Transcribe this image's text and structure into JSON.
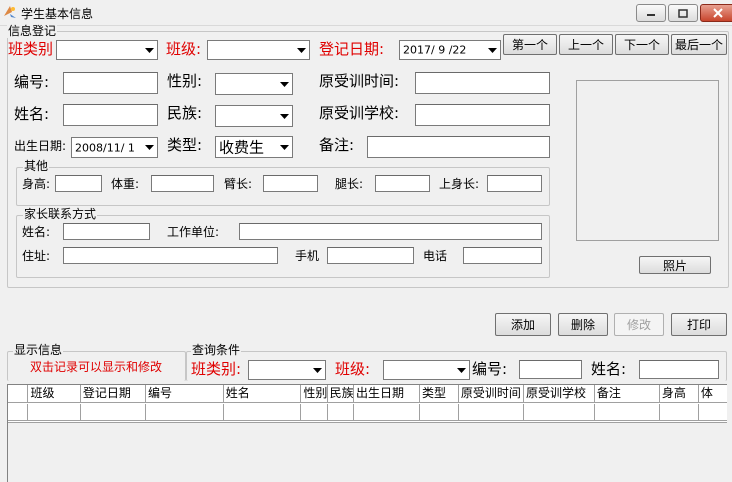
{
  "window": {
    "title": "学生基本信息"
  },
  "info_group": {
    "legend": "信息登记",
    "class_type_label": "班类别",
    "class_label": "班级:",
    "reg_date_label": "登记日期:",
    "reg_date_value": "2017/ 9 /22",
    "nav_first": "第一个",
    "nav_prev": "上一个",
    "nav_next": "下一个",
    "nav_last": "最后一个",
    "id_label": "编号:",
    "gender_label": "性别:",
    "orig_time_label": "原受训时间:",
    "name_label": "姓名:",
    "ethnic_label": "民族:",
    "orig_school_label": "原受训学校:",
    "birth_label": "出生日期:",
    "birth_value": "2008/11/ 1",
    "type_label": "类型:",
    "type_value": "收费生",
    "remark_label": "备注:"
  },
  "other_group": {
    "legend": "其他",
    "height_label": "身高:",
    "weight_label": "体重:",
    "arm_label": "臂长:",
    "leg_label": "腿长:",
    "upper_label": "上身长:"
  },
  "parent_group": {
    "legend": "家长联系方式",
    "name_label": "姓名:",
    "work_label": "工作单位:",
    "address_label": "住址:",
    "mobile_label": "手机",
    "phone_label": "电话"
  },
  "photo_button": "照片",
  "actions": {
    "add": "添加",
    "delete": "删除",
    "modify": "修改",
    "print": "打印"
  },
  "display_group": {
    "legend": "显示信息",
    "hint": "双击记录可以显示和修改"
  },
  "query_group": {
    "legend": "查询条件",
    "class_type_label": "班类别:",
    "class_label": "班级:",
    "id_label": "编号:",
    "name_label": "姓名:"
  },
  "table": {
    "columns": [
      "班级",
      "登记日期",
      "编号",
      "姓名",
      "性别",
      "民族",
      "出生日期",
      "类型",
      "原受训时间",
      "原受训学校",
      "备注",
      "身高",
      "体"
    ]
  },
  "colors": {
    "label_red": "#e00000",
    "background": "#f0f0f0"
  }
}
